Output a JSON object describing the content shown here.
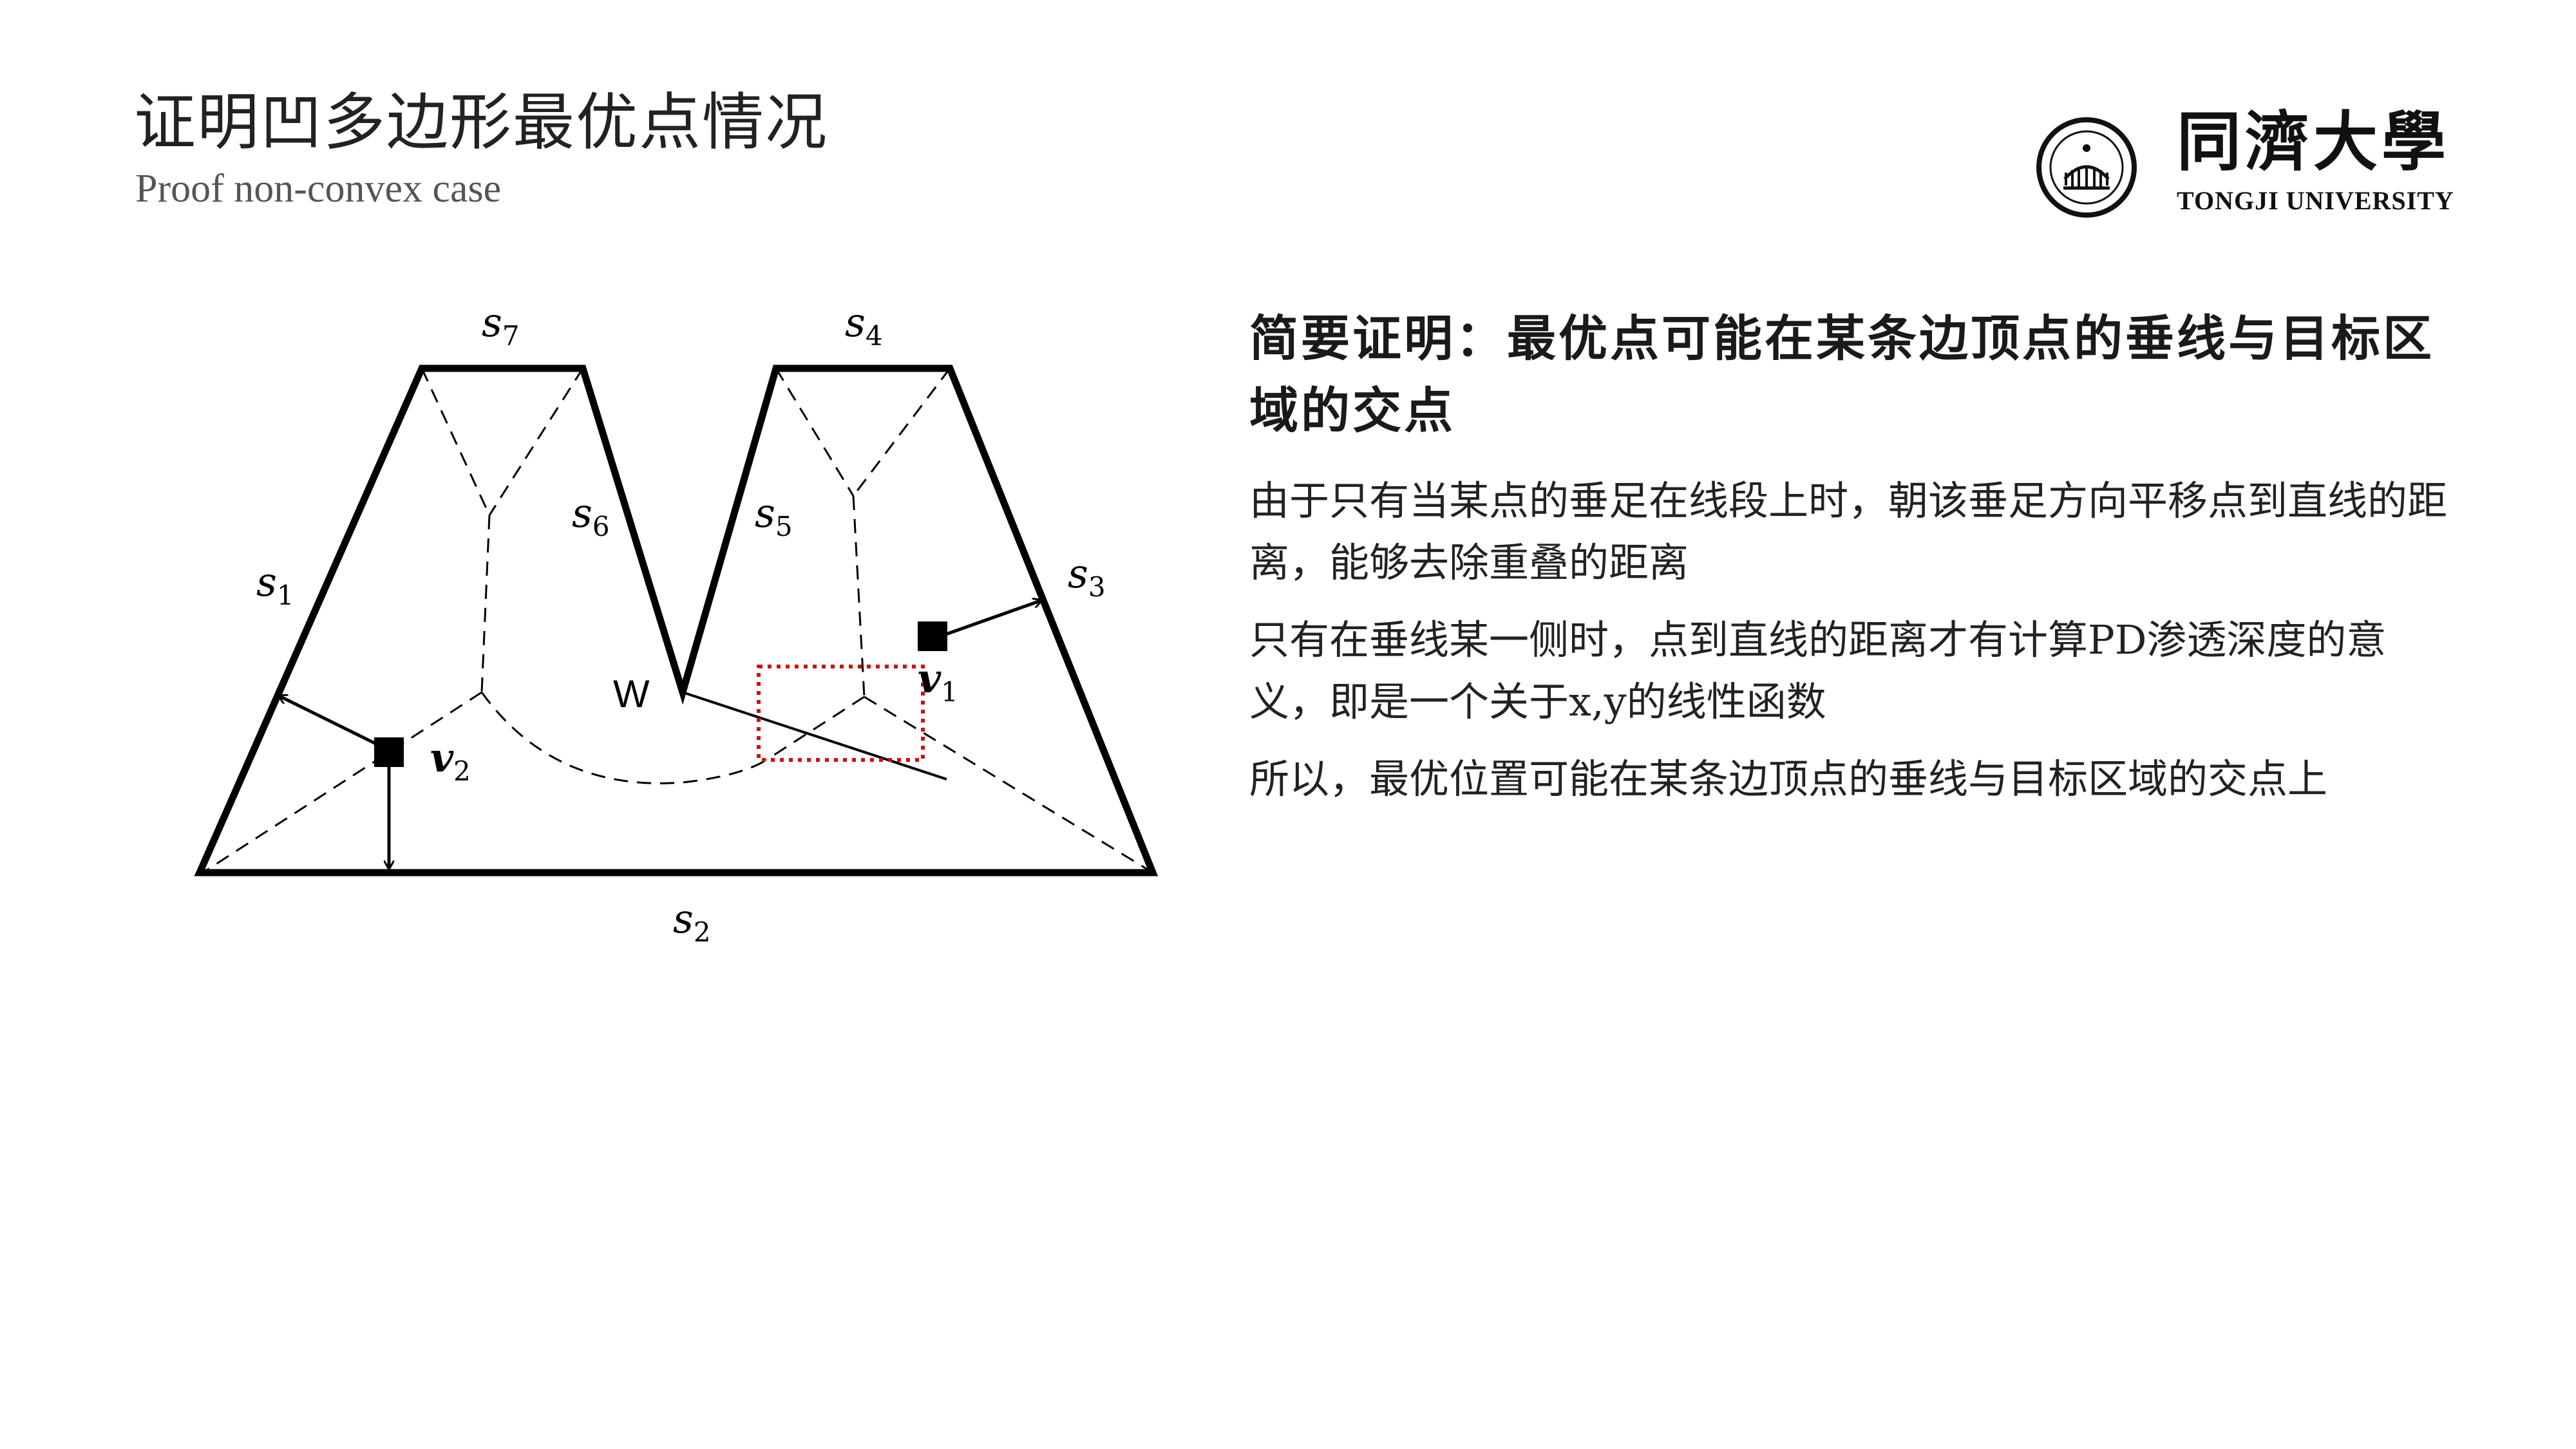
{
  "header": {
    "title": "证明凹多边形最优点情况",
    "subtitle": "Proof non-convex case"
  },
  "logo": {
    "cn_text": "同濟大學",
    "en_text": "TONGJI UNIVERSITY"
  },
  "diagram": {
    "edge_labels": {
      "s1": {
        "base": "s",
        "sub": "1"
      },
      "s2": {
        "base": "s",
        "sub": "2"
      },
      "s3": {
        "base": "s",
        "sub": "3"
      },
      "s4": {
        "base": "s",
        "sub": "4"
      },
      "s5": {
        "base": "s",
        "sub": "5"
      },
      "s6": {
        "base": "s",
        "sub": "6"
      },
      "s7": {
        "base": "s",
        "sub": "7"
      }
    },
    "vertex_w": "W",
    "point_v1": {
      "base": "v",
      "sub": "1"
    },
    "point_v2": {
      "base": "v",
      "sub": "2"
    },
    "highlight_color": "#cc1111"
  },
  "content": {
    "heading": "简要证明：最优点可能在某条边顶点的垂线与目标区域的交点",
    "paragraphs": [
      "由于只有当某点的垂足在线段上时，朝该垂足方向平移点到直线的距离，能够去除重叠的距离",
      "只有在垂线某一侧时，点到直线的距离才有计算PD渗透深度的意义，即是一个关于x,y的线性函数",
      "所以，最优位置可能在某条边顶点的垂线与目标区域的交点上"
    ]
  }
}
